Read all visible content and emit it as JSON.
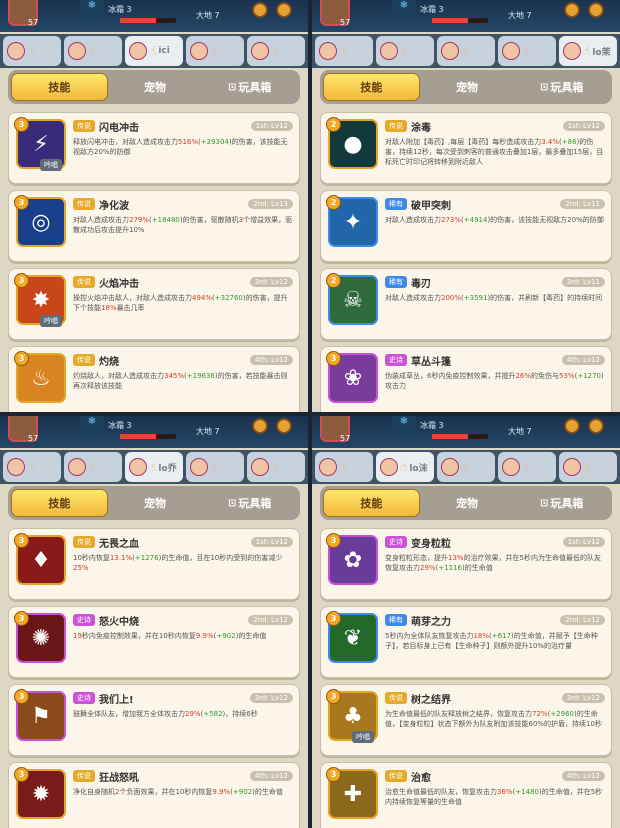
{
  "hud": {
    "level": "57",
    "frost_label": "冰霜",
    "frost_value": "3",
    "earth_label": "大地",
    "earth_value": "7"
  },
  "tabs": {
    "skills": "技能",
    "pets": "宠物",
    "toys": "玩具箱",
    "lock_icon": "lock-icon"
  },
  "colors": {
    "legendary": "#e6a92a",
    "epic": "#cc52d8",
    "rare": "#3d8be6",
    "highlight": "#d93a1d",
    "bonus": "#2f9a2a"
  },
  "panels": [
    {
      "hero_names": [
        "",
        "",
        "ici",
        "",
        ""
      ],
      "active": 2,
      "skills": [
        {
          "badge": "3",
          "rarity": "传说",
          "rtype": "legendary",
          "name": "闪电冲击",
          "slot": "1st: Lv12",
          "passive": "吟唱",
          "icon": "lightning-icon",
          "desc": [
            [
              "t",
              "释放闪电冲击，对敌人造成攻击力"
            ],
            [
              "h",
              "516%"
            ],
            [
              "t",
              "("
            ],
            [
              "b",
              "+29304"
            ],
            [
              "t",
              ")的伤害，该技能无视敌方20%的防御"
            ]
          ]
        },
        {
          "badge": "3",
          "rarity": "传说",
          "rtype": "legendary",
          "name": "净化波",
          "slot": "2nd: Lv13",
          "passive": "",
          "icon": "wave-icon",
          "desc": [
            [
              "t",
              "对敌人造成攻击力"
            ],
            [
              "h",
              "279%"
            ],
            [
              "t",
              "("
            ],
            [
              "b",
              "+18480"
            ],
            [
              "t",
              ")的伤害，驱散随机"
            ],
            [
              "h",
              "3"
            ],
            [
              "t",
              "个增益效果，驱散成功后攻击提升10%"
            ]
          ]
        },
        {
          "badge": "3",
          "rarity": "传说",
          "rtype": "legendary",
          "name": "火焰冲击",
          "slot": "3rd: Lv12",
          "passive": "吟唱",
          "icon": "fire-icon",
          "desc": [
            [
              "t",
              "操控火焰冲击敌人，对敌人造成攻击力"
            ],
            [
              "h",
              "494%"
            ],
            [
              "t",
              "("
            ],
            [
              "b",
              "+32760"
            ],
            [
              "t",
              ")的伤害，提升下个技能"
            ],
            [
              "h",
              "18%"
            ],
            [
              "t",
              "暴击几率"
            ]
          ]
        },
        {
          "badge": "3",
          "rarity": "传说",
          "rtype": "legendary",
          "name": "灼烧",
          "slot": "4th: Lv12",
          "passive": "",
          "icon": "burn-icon",
          "desc": [
            [
              "t",
              "灼烧敌人，对敌人造成攻击力"
            ],
            [
              "h",
              "345%"
            ],
            [
              "t",
              "("
            ],
            [
              "b",
              "+19636"
            ],
            [
              "t",
              ")的伤害，若技能暴击则再次释放该技能"
            ]
          ]
        }
      ]
    },
    {
      "hero_names": [
        "",
        "",
        "",
        "",
        "lo茉"
      ],
      "active": 4,
      "skills": [
        {
          "badge": "2",
          "rarity": "传说",
          "rtype": "legendary",
          "name": "涂毒",
          "slot": "1st: Lv12",
          "passive": "",
          "icon": "poison-drop-icon",
          "desc": [
            [
              "t",
              "对敌人附加【毒药】,每层【毒药】每秒造成攻击力"
            ],
            [
              "h",
              "3.4%"
            ],
            [
              "t",
              "("
            ],
            [
              "b",
              "+86"
            ],
            [
              "t",
              ")的伤害，持续12秒，每次受到刺客的普通攻击叠加1层，最多叠加15层，目标死亡时印记将转移到附近敌人"
            ]
          ]
        },
        {
          "badge": "2",
          "rarity": "稀有",
          "rtype": "rare",
          "name": "破甲突刺",
          "slot": "2nd: Lv11",
          "passive": "",
          "icon": "pierce-icon",
          "desc": [
            [
              "t",
              "对敌人造成攻击力"
            ],
            [
              "h",
              "273%"
            ],
            [
              "t",
              "("
            ],
            [
              "b",
              "+4914"
            ],
            [
              "t",
              ")的伤害，该技能无视敌方20%的防御"
            ]
          ]
        },
        {
          "badge": "2",
          "rarity": "稀有",
          "rtype": "rare",
          "name": "毒刃",
          "slot": "3rd: Lv11",
          "passive": "",
          "icon": "skull-icon",
          "desc": [
            [
              "t",
              "对敌人造成攻击力"
            ],
            [
              "h",
              "200%"
            ],
            [
              "t",
              "("
            ],
            [
              "b",
              "+3591"
            ],
            [
              "t",
              ")的伤害，并刷新【毒药】的持续时间"
            ]
          ]
        },
        {
          "badge": "3",
          "rarity": "史诗",
          "rtype": "epic",
          "name": "草丛斗篷",
          "slot": "4th: Lv12",
          "passive": "",
          "icon": "bush-icon",
          "desc": [
            [
              "t",
              "伪装成草丛，6秒内免疫控制效果，并提升"
            ],
            [
              "h",
              "26%"
            ],
            [
              "t",
              "的免伤与"
            ],
            [
              "h",
              "53%"
            ],
            [
              "t",
              "("
            ],
            [
              "b",
              "+1270"
            ],
            [
              "t",
              ")攻击力"
            ]
          ]
        }
      ]
    },
    {
      "hero_names": [
        "",
        "",
        "lo乔",
        "",
        ""
      ],
      "active": 2,
      "skills": [
        {
          "badge": "3",
          "rarity": "传说",
          "rtype": "legendary",
          "name": "无畏之血",
          "slot": "1st: Lv12",
          "passive": "",
          "icon": "blood-icon",
          "desc": [
            [
              "t",
              "10秒内恢复"
            ],
            [
              "h",
              "13.1%"
            ],
            [
              "t",
              "("
            ],
            [
              "b",
              "+1276"
            ],
            [
              "t",
              ")的生命值，且在10秒内受到的伤害减少"
            ],
            [
              "h",
              "25%"
            ]
          ]
        },
        {
          "badge": "3",
          "rarity": "史诗",
          "rtype": "epic",
          "name": "怒火中烧",
          "slot": "2nd: Lv12",
          "passive": "",
          "icon": "rage-icon",
          "desc": [
            [
              "h",
              "19"
            ],
            [
              "t",
              "秒内免疫控制效果，并在10秒内恢复"
            ],
            [
              "h",
              "9.9%"
            ],
            [
              "t",
              "("
            ],
            [
              "b",
              "+902"
            ],
            [
              "t",
              ")的生命值"
            ]
          ]
        },
        {
          "badge": "3",
          "rarity": "史诗",
          "rtype": "epic",
          "name": "我们上!",
          "slot": "3rd: Lv12",
          "passive": "",
          "icon": "banner-icon",
          "desc": [
            [
              "t",
              "鼓舞全体队友，增加我方全体攻击力"
            ],
            [
              "h",
              "29%"
            ],
            [
              "t",
              "("
            ],
            [
              "b",
              "+582"
            ],
            [
              "t",
              ")，持续6秒"
            ]
          ]
        },
        {
          "badge": "3",
          "rarity": "传说",
          "rtype": "legendary",
          "name": "狂战怒吼",
          "slot": "4th: Lv12",
          "passive": "",
          "icon": "roar-icon",
          "desc": [
            [
              "t",
              "净化自身随机"
            ],
            [
              "h",
              "2"
            ],
            [
              "t",
              "个负面效果，并在10秒内恢复"
            ],
            [
              "h",
              "9.9%"
            ],
            [
              "t",
              "("
            ],
            [
              "b",
              "+902"
            ],
            [
              "t",
              ")的生命值"
            ]
          ]
        }
      ]
    },
    {
      "hero_names": [
        "",
        "lo沫",
        "",
        "",
        ""
      ],
      "active": 1,
      "skills": [
        {
          "badge": "3",
          "rarity": "史诗",
          "rtype": "epic",
          "name": "变身粒粒",
          "slot": "1st: Lv12",
          "passive": "",
          "icon": "sprout-pet-icon",
          "desc": [
            [
              "t",
              "变身粒粒形态，提升"
            ],
            [
              "h",
              "13%"
            ],
            [
              "t",
              "的治疗效果，并在5秒内为生命值最低的队友恢复攻击力"
            ],
            [
              "h",
              "29%"
            ],
            [
              "t",
              "("
            ],
            [
              "b",
              "+1116"
            ],
            [
              "t",
              ")的生命值"
            ]
          ]
        },
        {
          "badge": "3",
          "rarity": "稀有",
          "rtype": "rare",
          "name": "萌芽之力",
          "slot": "2nd: Lv12",
          "passive": "",
          "icon": "seed-icon",
          "desc": [
            [
              "t",
              "5秒内为全体队友恢复攻击力"
            ],
            [
              "h",
              "18%"
            ],
            [
              "t",
              "("
            ],
            [
              "b",
              "+617"
            ],
            [
              "t",
              ")的生命值，并赋予【生命种子】，若目标身上已有【生命种子】则额外提升10%的治疗量"
            ]
          ]
        },
        {
          "badge": "3",
          "rarity": "传说",
          "rtype": "legendary",
          "name": "树之结界",
          "slot": "3rd: Lv12",
          "passive": "吟唱",
          "icon": "tree-icon",
          "desc": [
            [
              "t",
              "为生命值最低的队友释放树之结界，恢复攻击力"
            ],
            [
              "h",
              "72%"
            ],
            [
              "t",
              "("
            ],
            [
              "b",
              "+2960"
            ],
            [
              "t",
              ")的生命值，【变身粒粒】状态下额外为队友附加该技能60%的护盾，持续10秒"
            ]
          ]
        },
        {
          "badge": "3",
          "rarity": "传说",
          "rtype": "legendary",
          "name": "治愈",
          "slot": "4th: Lv12",
          "passive": "",
          "icon": "heal-cross-icon",
          "desc": [
            [
              "t",
              "治愈生命值最低的队友，恢复攻击力"
            ],
            [
              "h",
              "36%"
            ],
            [
              "t",
              "("
            ],
            [
              "b",
              "+1480"
            ],
            [
              "t",
              ")的生命值，并在5秒内持续恢复等量的生命值"
            ]
          ]
        }
      ]
    }
  ]
}
